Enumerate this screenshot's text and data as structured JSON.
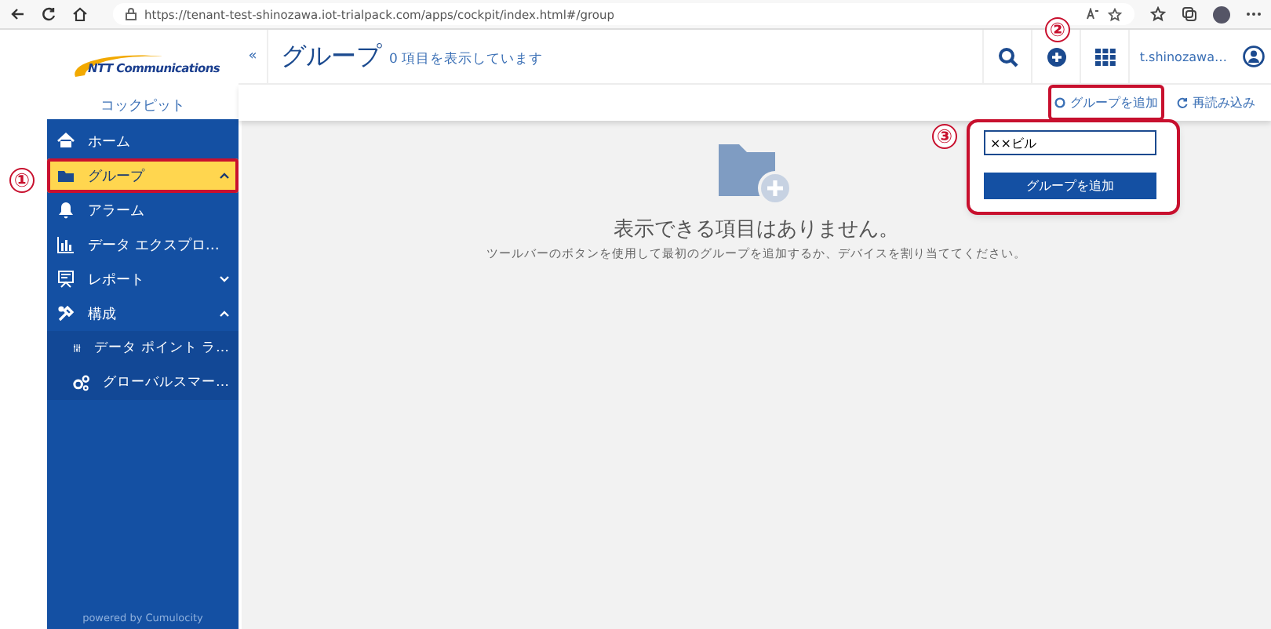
{
  "browser": {
    "url": "https://tenant-test-shinozawa.iot-trialpack.com/apps/cockpit/index.html#/group"
  },
  "sidebar": {
    "brand": "NTT Communications",
    "app_name": "コックピット",
    "footer": "powered by Cumulocity",
    "items": [
      {
        "label": "ホーム",
        "kind": "item",
        "selected": false,
        "highlighted": false
      },
      {
        "label": "グループ",
        "kind": "item",
        "selected": true,
        "expanded": true,
        "highlighted": true
      },
      {
        "label": "アラーム",
        "kind": "item",
        "selected": false,
        "highlighted": false
      },
      {
        "label": "データ エクスプロ…",
        "kind": "item",
        "selected": false,
        "highlighted": false
      },
      {
        "label": "レポート",
        "kind": "item",
        "selected": false,
        "expanded": false,
        "highlighted": false
      },
      {
        "label": "構成",
        "kind": "item",
        "selected": false,
        "expanded": true,
        "highlighted": false
      },
      {
        "label": "データ ポイント ラ…",
        "kind": "sub",
        "selected": false,
        "highlighted": false
      },
      {
        "label": "グローバルスマー…",
        "kind": "sub",
        "selected": false,
        "highlighted": false
      }
    ]
  },
  "header": {
    "collapse": "«",
    "title": "グループ",
    "subtitle": "0 項目を表示しています",
    "user": "t.shinozawa…"
  },
  "actions": [
    {
      "label": "グループを追加",
      "kind": "add",
      "highlighted": true
    },
    {
      "label": "再読み込み",
      "kind": "reload",
      "highlighted": false
    }
  ],
  "popover": {
    "value": "××ビル",
    "button": "グループを追加",
    "highlighted": true
  },
  "empty_state": {
    "title": "表示できる項目はありません。",
    "hint": "ツールバーのボタンを使用して最初のグループを追加するか、デバイスを割り当ててください。"
  },
  "annotations": [
    {
      "label": "①",
      "kind": "sidebar"
    },
    {
      "label": "②",
      "kind": "action"
    },
    {
      "label": "③",
      "kind": "popover"
    }
  ]
}
